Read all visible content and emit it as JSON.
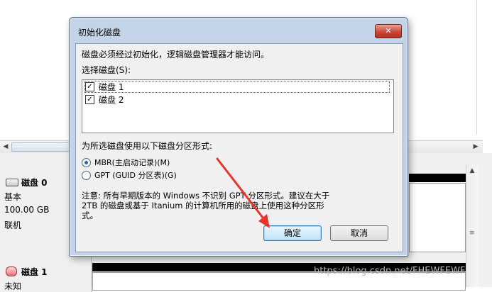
{
  "dialog": {
    "title": "初始化磁盘",
    "close_label": "✕",
    "intro": "磁盘必须经过初始化，逻辑磁盘管理器才能访问。",
    "select_label": "选择磁盘(S):",
    "disks": [
      {
        "label": "磁盘 1",
        "checked": true
      },
      {
        "label": "磁盘 2",
        "checked": true
      }
    ],
    "partition_label": "为所选磁盘使用以下磁盘分区形式:",
    "options": [
      {
        "label": "MBR(主启动记录)(M)",
        "selected": true
      },
      {
        "label": "GPT (GUID 分区表)(G)",
        "selected": false
      }
    ],
    "note_line1": "注意: 所有早期版本的 Windows 不识别 GPT 分区形式。建议在大于",
    "note_line2": "2TB 的磁盘或基于 Itanium 的计算机所用的磁盘上使用这种分区形",
    "note_line3": "式。",
    "ok_label": "确定",
    "cancel_label": "取消"
  },
  "disk_list": [
    {
      "name": "磁盘 0",
      "type": "基本",
      "size": "100.00 GB",
      "status": "联机"
    },
    {
      "name": "磁盘 1",
      "type": "未知"
    }
  ],
  "watermark": "https://blog.csdn.net/FHEWFEWF",
  "colors": {
    "arrow": "#e8352a",
    "dialog_frame": "#c3d4e8",
    "default_button": "#bfe3f8"
  }
}
